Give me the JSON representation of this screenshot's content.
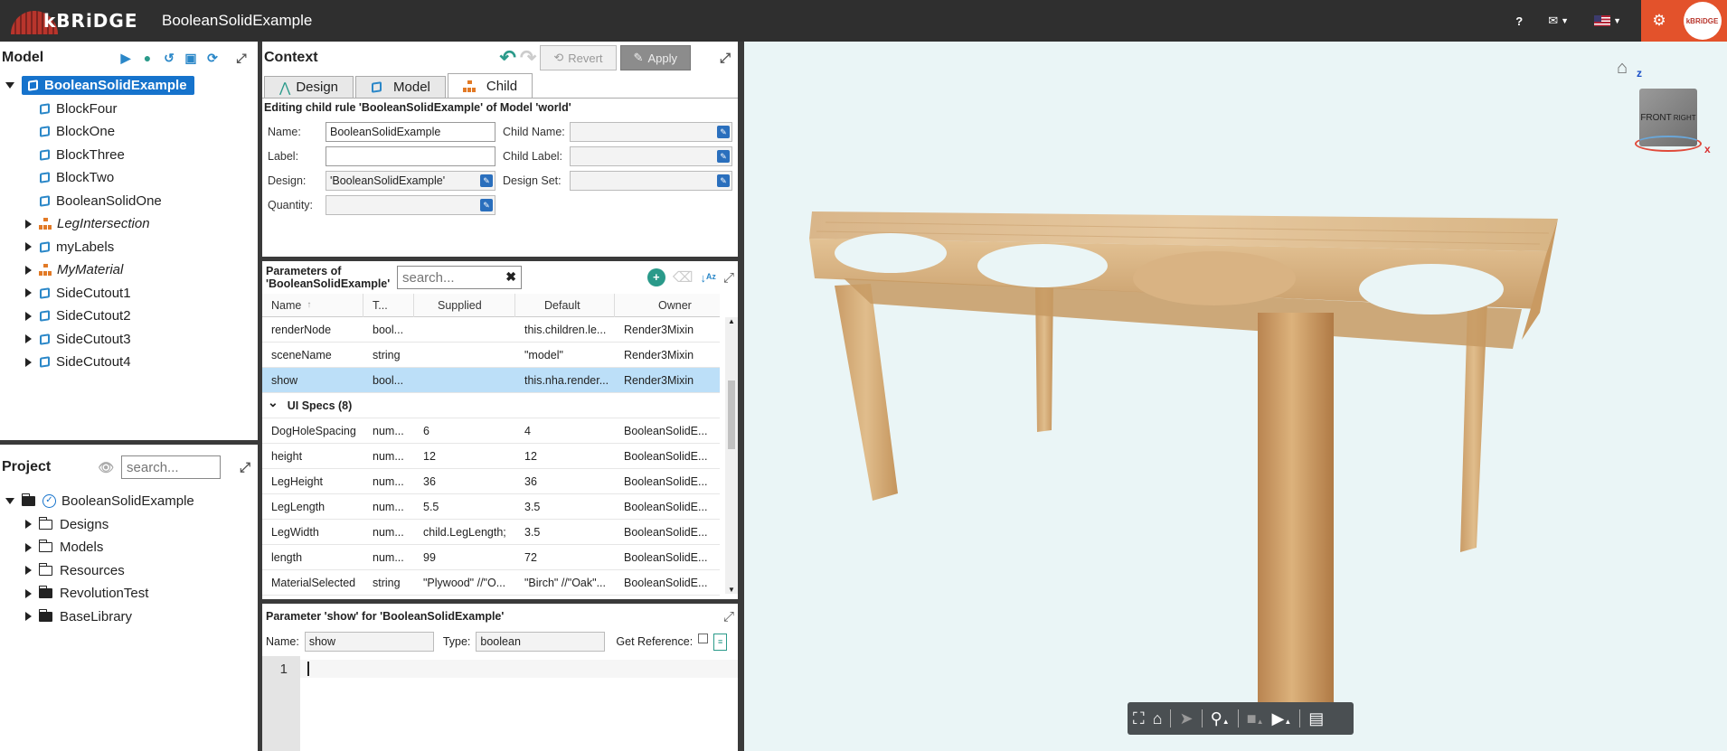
{
  "app": {
    "brand": "kBRiDGE",
    "title": "BooleanSolidExample",
    "help": "?",
    "corner_logo": "kBRiDGE"
  },
  "model_panel": {
    "title": "Model",
    "tree": [
      {
        "label": "BooleanSolidExample",
        "icon": "cube-icon",
        "selected": true,
        "expanded": true
      },
      {
        "label": "BlockFour",
        "icon": "cube-icon"
      },
      {
        "label": "BlockOne",
        "icon": "cube-icon"
      },
      {
        "label": "BlockThree",
        "icon": "cube-icon"
      },
      {
        "label": "BlockTwo",
        "icon": "cube-icon"
      },
      {
        "label": "BooleanSolidOne",
        "icon": "cube-icon"
      },
      {
        "label": "LegIntersection",
        "icon": "org-icon",
        "italic": true,
        "collapsed": true
      },
      {
        "label": "myLabels",
        "icon": "cube-icon",
        "collapsed": true
      },
      {
        "label": "MyMaterial",
        "icon": "org-icon",
        "italic": true,
        "collapsed": true
      },
      {
        "label": "SideCutout1",
        "icon": "cube-icon",
        "collapsed": true
      },
      {
        "label": "SideCutout2",
        "icon": "cube-icon",
        "collapsed": true
      },
      {
        "label": "SideCutout3",
        "icon": "cube-icon",
        "collapsed": true
      },
      {
        "label": "SideCutout4",
        "icon": "cube-icon",
        "collapsed": true
      }
    ]
  },
  "project_panel": {
    "title": "Project",
    "search_placeholder": "search...",
    "tree": [
      {
        "label": "BooleanSolidExample",
        "icon": "folder-open-icon",
        "expanded": true
      },
      {
        "label": "Designs",
        "icon": "folder-icon"
      },
      {
        "label": "Models",
        "icon": "folder-icon"
      },
      {
        "label": "Resources",
        "icon": "folder-icon"
      },
      {
        "label": "RevolutionTest",
        "icon": "folder-filled-icon"
      },
      {
        "label": "BaseLibrary",
        "icon": "folder-filled-icon"
      }
    ]
  },
  "context": {
    "title": "Context",
    "revert_label": "Revert",
    "apply_label": "Apply",
    "tabs": [
      {
        "label": "Design",
        "icon": "design-icon"
      },
      {
        "label": "Model",
        "icon": "cube-icon"
      },
      {
        "label": "Child",
        "icon": "org-icon",
        "active": true
      }
    ],
    "editing_text": "Editing child rule 'BooleanSolidExample' of Model 'world'",
    "fields": {
      "name_label": "Name:",
      "name_value": "BooleanSolidExample",
      "label_label": "Label:",
      "label_value": "",
      "design_label": "Design:",
      "design_value": "'BooleanSolidExample'",
      "quantity_label": "Quantity:",
      "quantity_value": "",
      "child_name_label": "Child Name:",
      "child_label_label": "Child Label:",
      "design_set_label": "Design Set:"
    }
  },
  "parameters": {
    "title_line1": "Parameters of",
    "title_line2": "'BooleanSolidExample'",
    "search_placeholder": "search...",
    "columns": [
      "Name",
      "T...",
      "Supplied",
      "Default",
      "Owner"
    ],
    "rows": [
      {
        "name": "renderNode",
        "type": "bool...",
        "supplied": "",
        "default": "this.children.le...",
        "owner": "Render3Mixin"
      },
      {
        "name": "sceneName",
        "type": "string",
        "supplied": "",
        "default": "\"model\"",
        "owner": "Render3Mixin"
      },
      {
        "name": "show",
        "type": "bool...",
        "supplied": "",
        "default": "this.nha.render...",
        "owner": "Render3Mixin",
        "selected": true
      }
    ],
    "group_label": "UI Specs (8)",
    "group_rows": [
      {
        "name": "DogHoleSpacing",
        "type": "num...",
        "supplied": "6",
        "default": "4",
        "owner": "BooleanSolidE..."
      },
      {
        "name": "height",
        "type": "num...",
        "supplied": "12",
        "default": "12",
        "owner": "BooleanSolidE..."
      },
      {
        "name": "LegHeight",
        "type": "num...",
        "supplied": "36",
        "default": "36",
        "owner": "BooleanSolidE..."
      },
      {
        "name": "LegLength",
        "type": "num...",
        "supplied": "5.5",
        "default": "3.5",
        "owner": "BooleanSolidE..."
      },
      {
        "name": "LegWidth",
        "type": "num...",
        "supplied": "child.LegLength;",
        "default": "3.5",
        "owner": "BooleanSolidE..."
      },
      {
        "name": "length",
        "type": "num...",
        "supplied": "99",
        "default": "72",
        "owner": "BooleanSolidE..."
      },
      {
        "name": "MaterialSelected",
        "type": "string",
        "supplied": "\"Plywood\" //\"O...",
        "default": "\"Birch\" //\"Oak\"...",
        "owner": "BooleanSolidE..."
      }
    ]
  },
  "param_detail": {
    "title": "Parameter 'show' for 'BooleanSolidExample'",
    "name_label": "Name:",
    "name_value": "show",
    "type_label": "Type:",
    "type_value": "boolean",
    "get_ref_label": "Get Reference:",
    "line_number": "1"
  },
  "viewer": {
    "axis_z": "z",
    "axis_x": "x",
    "cube_front": "FRONT",
    "cube_right": "RIGHT",
    "toolbar_icons": [
      "fullscreen-icon",
      "home-icon",
      "select-icon",
      "person-icon",
      "camera-icon",
      "video-icon",
      "pdf-icon"
    ]
  }
}
